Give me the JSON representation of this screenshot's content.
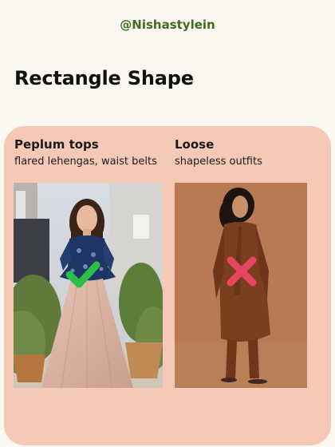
{
  "handle": "@Nishastylein",
  "title": "Rectangle Shape",
  "columns": [
    {
      "heading": "Peplum tops",
      "subheading": "flared lehengas, waist belts",
      "verdict_icon": "check-icon"
    },
    {
      "heading": "Loose",
      "subheading": "shapeless outfits",
      "verdict_icon": "cross-icon"
    }
  ],
  "colors": {
    "background": "#fbf8f2",
    "panel": "#f6c8b6",
    "handle": "#3e6b1f",
    "check": "#2bbf4a",
    "cross": "#e8455e"
  }
}
